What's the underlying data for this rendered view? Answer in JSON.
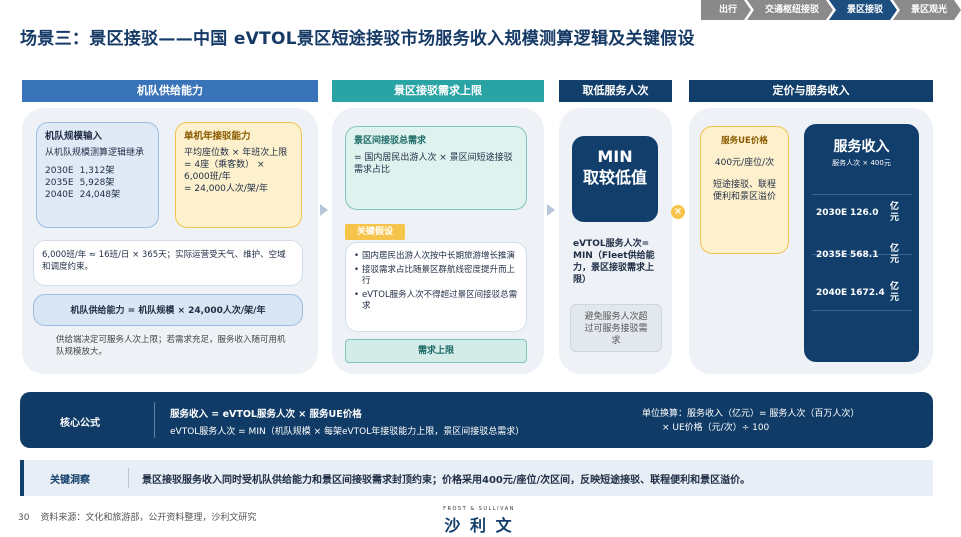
{
  "nav": {
    "items": [
      {
        "label": "出行",
        "active": false
      },
      {
        "label": "交通枢纽接驳",
        "active": false
      },
      {
        "label": "景区接驳",
        "active": true
      },
      {
        "label": "景区观光",
        "active": false
      }
    ]
  },
  "title": "场景三：景区接驳——中国 eVTOL景区短途接驳市场服务收入规模测算逻辑及关键假设",
  "sections": {
    "fleet": {
      "header": "机队供给能力",
      "fleet_input_title": "机队规模输入",
      "fleet_input_desc": "从机队规模测算逻辑继承",
      "fleet_rows": [
        {
          "year": "2030E",
          "value": "1,312架"
        },
        {
          "year": "2035E",
          "value": "5,928架"
        },
        {
          "year": "2040E",
          "value": "24,048架"
        }
      ],
      "capacity_title": "单机年接驳能力",
      "capacity_desc": "平均座位数 × 年班次上限\n= 4座（乘客数） × 6,000班/年\n= 24,000人次/架/年",
      "assumption_note": "6,000班/年 ≈ 16班/日 × 365天；实际运营受天气、维护、空域和调度约束。",
      "formula_box": "机队供给能力 = 机队规模 × 24,000人次/架/年",
      "footnote": "供给端决定可服务人次上限；若需求充足，服务收入随可用机队规模放大。"
    },
    "demand": {
      "header": "景区接驳需求上限",
      "total_title": "景区间接驳总需求",
      "total_desc": "= 国内居民出游人次 × 景区间短途接驳需求占比",
      "key_label": "关键假设",
      "assumptions": [
        "国内居民出游人次按中长期旅游增长推演",
        "接驳需求占比随景区群航线密度提升而上行",
        "eVTOL服务人次不得超过景区间接驳总需求"
      ],
      "cap_label": "需求上限"
    },
    "min": {
      "header": "取低服务人次",
      "min_text": "MIN\n取较低值",
      "eq_text": "eVTOL服务人次= MIN（Fleet供给能力，景区接驳需求上限）",
      "note": "避免服务人次超过可服务接驳需求"
    },
    "revenue": {
      "header": "定价与服务收入",
      "price_title": "服务UE价格",
      "price_value": "400元/座位/次",
      "price_desc": "短途接驳、联程便利和景区溢价",
      "rev_title": "服务收入",
      "rev_sub": "服务人次 × 400元",
      "unit": "亿元",
      "rows": [
        {
          "year": "2030E",
          "value": "126.0"
        },
        {
          "year": "2035E",
          "value": "568.1"
        },
        {
          "year": "2040E",
          "value": "1672.4"
        }
      ]
    }
  },
  "formula": {
    "label": "核心公式",
    "line1": "服务收入 = eVTOL服务人次 × 服务UE价格",
    "line2": "eVTOL服务人次 = MIN（机队规模 × 每架eVTOL年接驳能力上限，景区间接驳总需求）",
    "unit1": "单位换算：服务收入（亿元）= 服务人次（百万人次）",
    "unit2": "× UE价格（元/次）÷ 100"
  },
  "insight": {
    "label": "关键洞察",
    "text": "景区接驳服务收入同时受机队供给能力和景区间接驳需求封顶约束；价格采用400元/座位/次区间，反映短途接驳、联程便利和景区溢价。"
  },
  "footer": {
    "page": "30",
    "source": "资料来源：文化和旅游部，公开资料整理，沙利文研究",
    "logo_en": "FROST & SULLIVAN",
    "logo_cn": "沙 利 文"
  },
  "colors": {
    "navy": "#123e6b",
    "blue_header": "#3a74b8",
    "teal_header": "#2aa3a5",
    "yellow": "#f6c44a"
  }
}
